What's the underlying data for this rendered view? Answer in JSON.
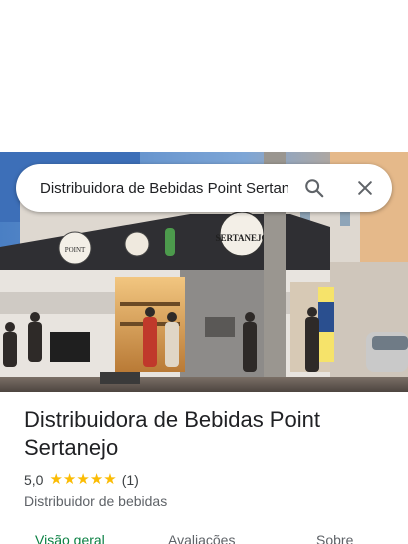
{
  "search": {
    "query": "Distribuidora de Bebidas Point Sertanejo"
  },
  "place": {
    "name": "Distribuidora de Bebidas Point Sertanejo",
    "rating": "5,0",
    "review_count": "(1)",
    "category": "Distribuidor de bebidas",
    "stars_filled": 5
  },
  "photo": {
    "sign_small": "POINT",
    "sign_big": "SERTANEJO"
  },
  "tabs": [
    {
      "label": "Visão geral",
      "active": true
    },
    {
      "label": "Avaliações",
      "active": false
    },
    {
      "label": "Sobre",
      "active": false
    }
  ],
  "colors": {
    "accent": "#0b8043",
    "star": "#fbbc04"
  }
}
